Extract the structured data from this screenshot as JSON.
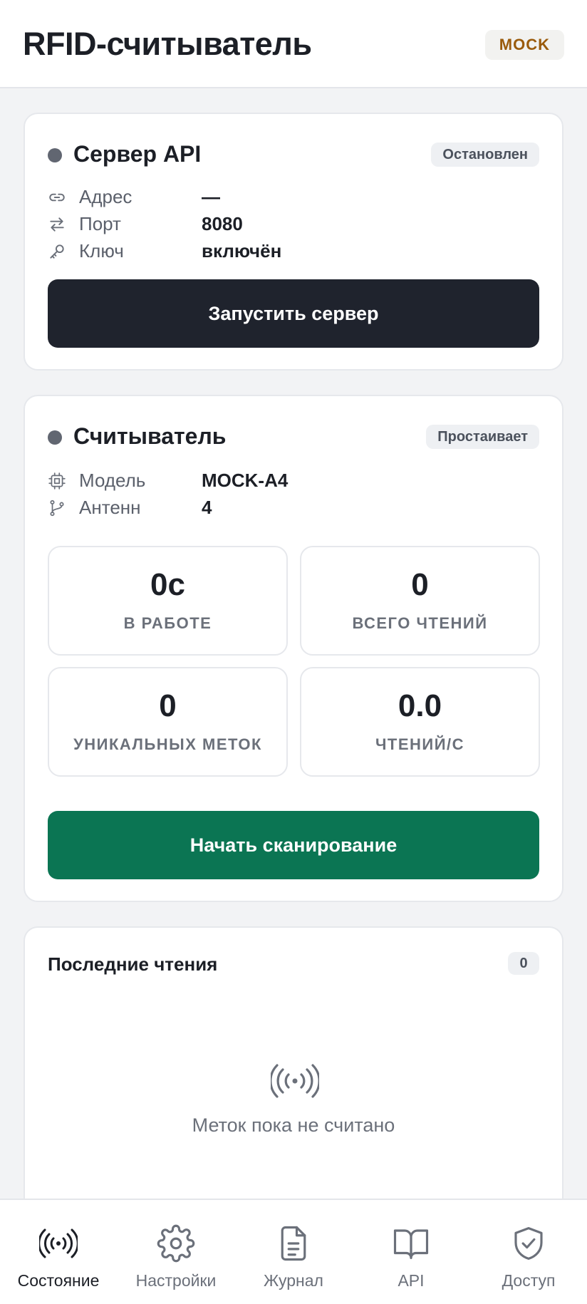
{
  "header": {
    "title": "RFID-считыватель",
    "mode_badge": "MOCK"
  },
  "server": {
    "title": "Сервер API",
    "status": "Остановлен",
    "status_color": "#616671",
    "rows": [
      {
        "icon": "link-icon",
        "label": "Адрес",
        "value": "—"
      },
      {
        "icon": "arrows-swap-icon",
        "label": "Порт",
        "value": "8080"
      },
      {
        "icon": "key-icon",
        "label": "Ключ",
        "value": "включён"
      }
    ],
    "button_label": "Запустить сервер"
  },
  "reader": {
    "title": "Считыватель",
    "status": "Простаивает",
    "status_color": "#616671",
    "rows": [
      {
        "icon": "chip-icon",
        "label": "Модель",
        "value": "MOCK-A4"
      },
      {
        "icon": "branch-icon",
        "label": "Антенн",
        "value": "4"
      }
    ],
    "stats": [
      {
        "value": "0с",
        "label": "В РАБОТЕ"
      },
      {
        "value": "0",
        "label": "ВСЕГО ЧТЕНИЙ"
      },
      {
        "value": "0",
        "label": "УНИКАЛЬНЫХ МЕТОК"
      },
      {
        "value": "0.0",
        "label": "ЧТЕНИЙ/С"
      }
    ],
    "button_label": "Начать сканирование"
  },
  "recent_reads": {
    "title": "Последние чтения",
    "count": "0",
    "empty_icon": "broadcast-icon",
    "empty_text": "Меток пока не считано"
  },
  "nav": {
    "items": [
      {
        "icon": "broadcast-icon",
        "label": "Состояние",
        "active": true
      },
      {
        "icon": "gear-icon",
        "label": "Настройки",
        "active": false
      },
      {
        "icon": "document-icon",
        "label": "Журнал",
        "active": false
      },
      {
        "icon": "book-icon",
        "label": "API",
        "active": false
      },
      {
        "icon": "shield-check-icon",
        "label": "Доступ",
        "active": false
      }
    ]
  },
  "colors": {
    "dark_button": "#1f232d",
    "green_button": "#0b7553",
    "mock_badge_text": "#9a5b0c"
  }
}
